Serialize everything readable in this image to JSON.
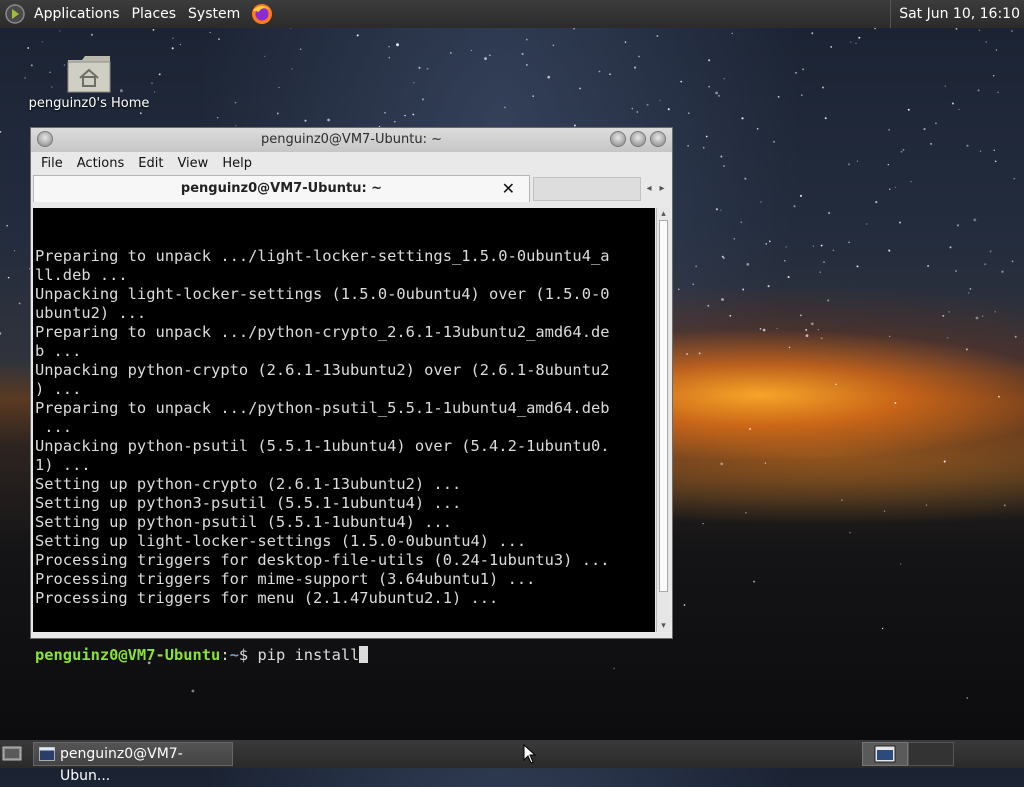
{
  "top_panel": {
    "applications_label": "Applications",
    "places_label": "Places",
    "system_label": "System",
    "clock": "Sat Jun 10, 16:10"
  },
  "desktop": {
    "home_icon_label": "penguinz0's Home"
  },
  "terminal_window": {
    "title": "penguinz0@VM7-Ubuntu: ~",
    "menu": [
      "File",
      "Actions",
      "Edit",
      "View",
      "Help"
    ],
    "tab_title": "penguinz0@VM7-Ubuntu: ~",
    "tab_close_glyph": "✕",
    "lines": [
      "Preparing to unpack .../light-locker-settings_1.5.0-0ubuntu4_a",
      "ll.deb ...",
      "Unpacking light-locker-settings (1.5.0-0ubuntu4) over (1.5.0-0",
      "ubuntu2) ...",
      "Preparing to unpack .../python-crypto_2.6.1-13ubuntu2_amd64.de",
      "b ...",
      "Unpacking python-crypto (2.6.1-13ubuntu2) over (2.6.1-8ubuntu2",
      ") ...",
      "Preparing to unpack .../python-psutil_5.5.1-1ubuntu4_amd64.deb",
      " ...",
      "Unpacking python-psutil (5.5.1-1ubuntu4) over (5.4.2-1ubuntu0.",
      "1) ...",
      "Setting up python-crypto (2.6.1-13ubuntu2) ...",
      "Setting up python3-psutil (5.5.1-1ubuntu4) ...",
      "Setting up python-psutil (5.5.1-1ubuntu4) ...",
      "Setting up light-locker-settings (1.5.0-0ubuntu4) ...",
      "Processing triggers for desktop-file-utils (0.24-1ubuntu3) ...",
      "Processing triggers for mime-support (3.64ubuntu1) ...",
      "Processing triggers for menu (2.1.47ubuntu2.1) ..."
    ],
    "prompt_user": "penguinz0@VM7-Ubuntu",
    "prompt_sep": ":",
    "prompt_path": "~",
    "prompt_symbol": "$ ",
    "command": "pip install"
  },
  "bottom_panel": {
    "task_label": "penguinz0@VM7-Ubun..."
  },
  "colors": {
    "prompt_user": "#8ae234",
    "prompt_path": "#729fcf",
    "terminal_bg": "#000000",
    "terminal_fg": "#dcdcdc"
  },
  "icons": [
    "mate-logo-icon",
    "firefox-icon",
    "home-folder-icon",
    "close-icon",
    "show-desktop-icon",
    "terminal-icon",
    "workspace-icon",
    "mouse-pointer-icon"
  ]
}
